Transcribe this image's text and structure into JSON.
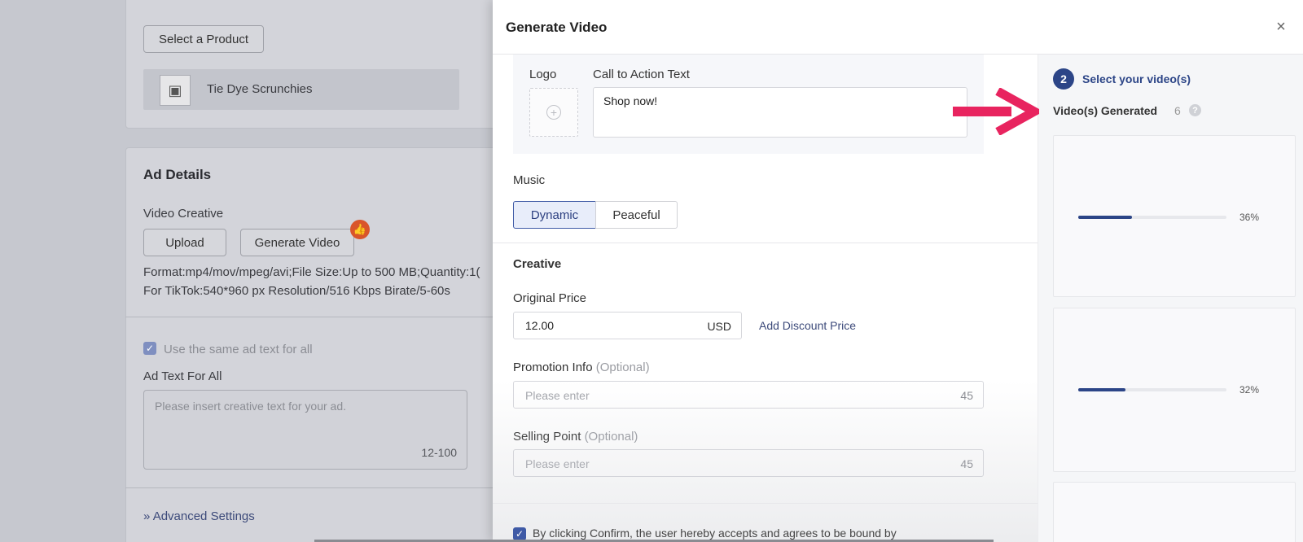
{
  "background": {
    "select_product_button": "Select a Product",
    "product_name": "Tie Dye Scrunchies",
    "ad_details_title": "Ad Details",
    "video_creative_label": "Video Creative",
    "upload_button": "Upload",
    "generate_video_button": "Generate Video",
    "format_line": "Format:mp4/mov/mpeg/avi;File Size:Up to 500 MB;Quantity:1(",
    "tiktok_line": "For TikTok:540*960 px Resolution/516 Kbps Birate/5-60s",
    "same_text_checkbox": "Use the same ad text for all",
    "ad_text_label": "Ad Text For All",
    "ad_text_placeholder": "Please insert creative text for your ad.",
    "ad_text_counter": "12-100",
    "advanced_settings": "Advanced Settings"
  },
  "drawer": {
    "title": "Generate Video",
    "close_icon": "×",
    "logo_label": "Logo",
    "cta_label": "Call to Action Text",
    "cta_value": "Shop now!",
    "music_label": "Music",
    "music_options": [
      "Dynamic",
      "Peaceful"
    ],
    "music_selected": "Dynamic",
    "creative_title": "Creative",
    "original_price_label": "Original Price",
    "original_price_value": "12.00",
    "currency": "USD",
    "add_discount_link": "Add Discount Price",
    "promotion_label": "Promotion Info",
    "promotion_optional": "(Optional)",
    "promotion_placeholder": "Please enter",
    "promotion_counter": "45",
    "selling_label": "Selling Point",
    "selling_optional": "(Optional)",
    "selling_placeholder": "Please enter",
    "selling_counter": "45",
    "agree_text": "By clicking Confirm, the user hereby accepts and agrees to be bound by"
  },
  "videos_panel": {
    "step_number": "2",
    "step_label": "Select your video(s)",
    "generated_title": "Video(s) Generated",
    "generated_count": "6",
    "help_icon": "?",
    "videos": [
      {
        "progress_label": "36%",
        "progress": 0.36
      },
      {
        "progress_label": "32%",
        "progress": 0.32
      }
    ]
  },
  "colors": {
    "accent": "#2c4587",
    "arrow": "#e8245f",
    "like_badge": "#d9552a"
  }
}
